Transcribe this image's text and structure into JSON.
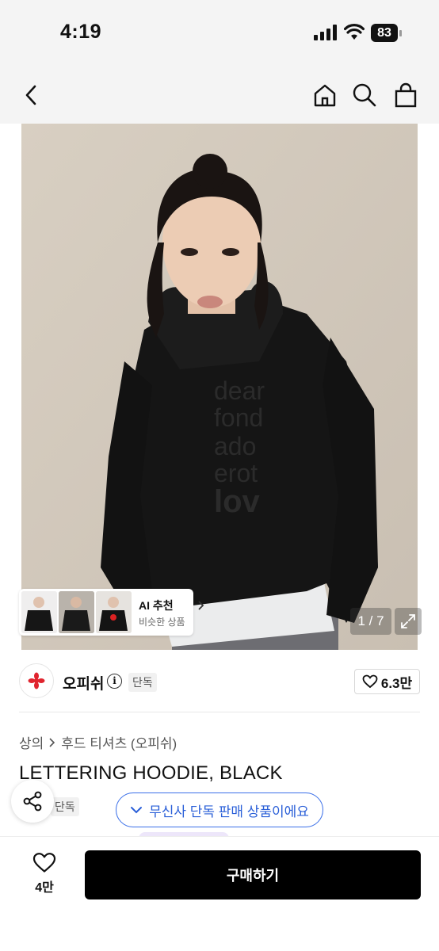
{
  "status_bar": {
    "time": "4:19",
    "battery": "83"
  },
  "top_nav": {
    "icons": [
      "back-icon",
      "home-icon",
      "search-icon",
      "shopping-bag-icon"
    ]
  },
  "gallery": {
    "counter": "1 / 7",
    "ai_card": {
      "title": "AI 추천",
      "subtitle": "비슷한 상품"
    }
  },
  "brand": {
    "name": "오피쉬",
    "exclusive_tag": "단독",
    "likes": "6.3만"
  },
  "breadcrumb": {
    "category": "상의",
    "subcategory": "후드 티셔츠 (오피쉬)"
  },
  "product": {
    "title": "LETTERING HOODIE, BLACK",
    "badge": "단독"
  },
  "notice": {
    "exclusive_pill": "무신사 단독 판매 상품이에요"
  },
  "bottom_bar": {
    "wish_count": "4만",
    "buy_label": "구매하기"
  },
  "colors": {
    "accent_blue": "#2a5fd8",
    "brand_red": "#e0242e",
    "buy_button": "#000000"
  }
}
